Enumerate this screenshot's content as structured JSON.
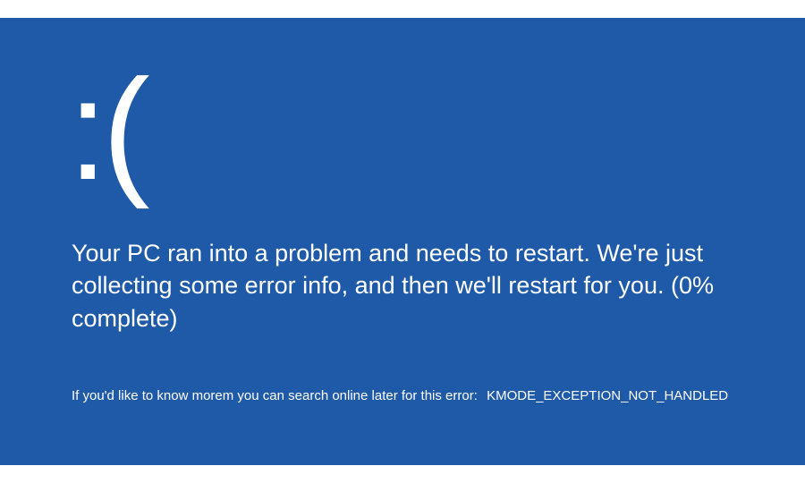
{
  "bsod": {
    "emoticon": ":(",
    "message": "Your PC ran into a problem and needs to restart. We're just collecting some error info, and then we'll restart for you. (0% complete)",
    "hint_prefix": "If you'd like to know morem you can search online later for this error:",
    "error_code": "KMODE_EXCEPTION_NOT_HANDLED"
  }
}
